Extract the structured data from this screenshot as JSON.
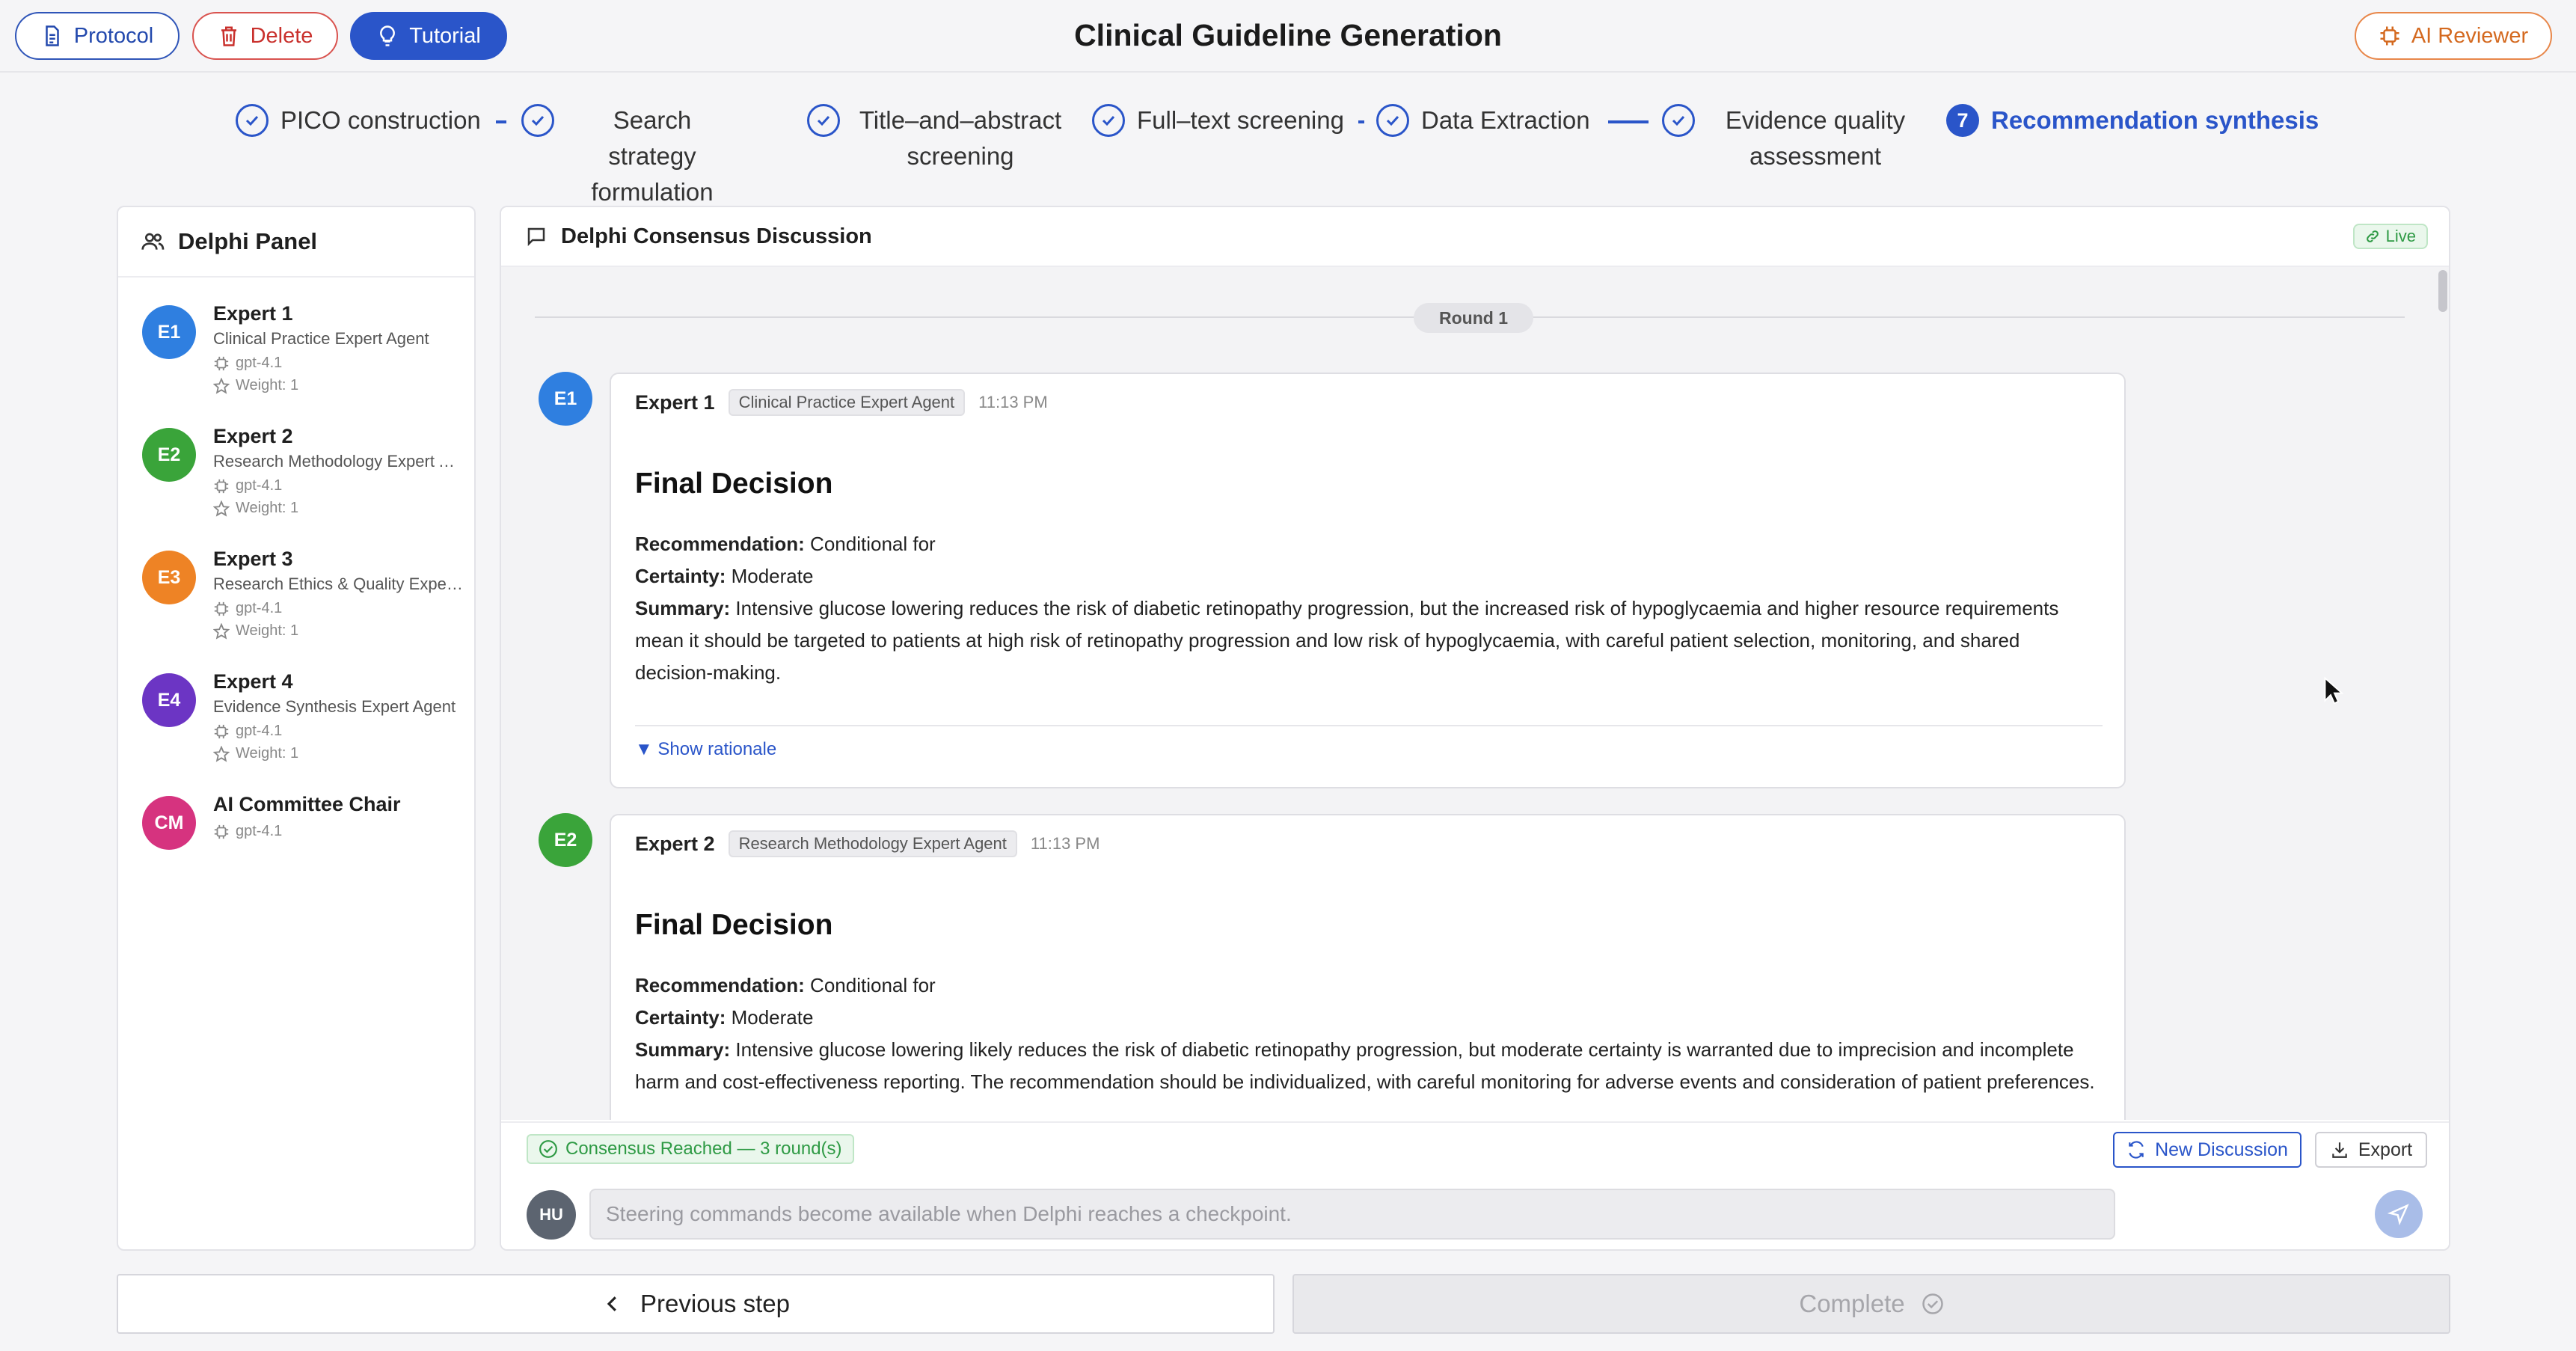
{
  "header": {
    "title": "Clinical Guideline Generation",
    "protocol_label": "Protocol",
    "delete_label": "Delete",
    "tutorial_label": "Tutorial",
    "reviewer_label": "AI Reviewer"
  },
  "steps": [
    {
      "label": "PICO construction",
      "status": "done"
    },
    {
      "label": "Search strategy formulation",
      "status": "done"
    },
    {
      "label": "Title–and–abstract screening",
      "status": "done"
    },
    {
      "label": "Full–text screening",
      "status": "done"
    },
    {
      "label": "Data Extraction",
      "status": "done"
    },
    {
      "label": "Evidence quality assessment",
      "status": "done"
    },
    {
      "number": "7",
      "label": "Recommendation synthesis",
      "status": "active"
    }
  ],
  "panel": {
    "title": "Delphi Panel",
    "experts": [
      {
        "initials": "E1",
        "name": "Expert 1",
        "role": "Clinical Practice Expert Agent",
        "model": "gpt-4.1",
        "weight": "Weight: 1",
        "color": "#2f7fe0"
      },
      {
        "initials": "E2",
        "name": "Expert 2",
        "role": "Research Methodology Expert Agent",
        "model": "gpt-4.1",
        "weight": "Weight: 1",
        "color": "#3aa43a"
      },
      {
        "initials": "E3",
        "name": "Expert 3",
        "role": "Research Ethics & Quality Expert Agent",
        "model": "gpt-4.1",
        "weight": "Weight: 1",
        "color": "#ee8325"
      },
      {
        "initials": "E4",
        "name": "Expert 4",
        "role": "Evidence Synthesis Expert Agent",
        "model": "gpt-4.1",
        "weight": "Weight: 1",
        "color": "#6c35c4"
      },
      {
        "initials": "CM",
        "name": "AI Committee Chair",
        "model": "gpt-4.1",
        "color": "#d6337f"
      }
    ]
  },
  "discussion": {
    "title": "Delphi Consensus Discussion",
    "live_label": "Live",
    "round_label": "Round 1",
    "messages": [
      {
        "initials": "E1",
        "name": "Expert 1",
        "tag": "Clinical Practice Expert Agent",
        "time": "11:13 PM",
        "heading": "Final Decision",
        "recommendation_label": "Recommendation:",
        "recommendation": "Conditional for",
        "certainty_label": "Certainty:",
        "certainty": "Moderate",
        "summary_label": "Summary:",
        "summary": "Intensive glucose lowering reduces the risk of diabetic retinopathy progression, but the increased risk of hypoglycaemia and higher resource requirements mean it should be targeted to patients at high risk of retinopathy progression and low risk of hypoglycaemia, with careful patient selection, monitoring, and shared decision-making.",
        "rationale_label": "▼ Show rationale"
      },
      {
        "initials": "E2",
        "name": "Expert 2",
        "tag": "Research Methodology Expert Agent",
        "time": "11:13 PM",
        "heading": "Final Decision",
        "recommendation_label": "Recommendation:",
        "recommendation": "Conditional for",
        "certainty_label": "Certainty:",
        "certainty": "Moderate",
        "summary_label": "Summary:",
        "summary": "Intensive glucose lowering likely reduces the risk of diabetic retinopathy progression, but moderate certainty is warranted due to imprecision and incomplete harm and cost-effectiveness reporting. The recommendation should be individualized, with careful monitoring for adverse events and consideration of patient preferences."
      }
    ],
    "consensus_label": "Consensus Reached — 3 round(s)",
    "new_discussion_label": "New Discussion",
    "export_label": "Export",
    "user_initials": "HU",
    "input_placeholder": "Steering commands become available when Delphi reaches a checkpoint."
  },
  "footer": {
    "previous_label": "Previous step",
    "complete_label": "Complete"
  }
}
